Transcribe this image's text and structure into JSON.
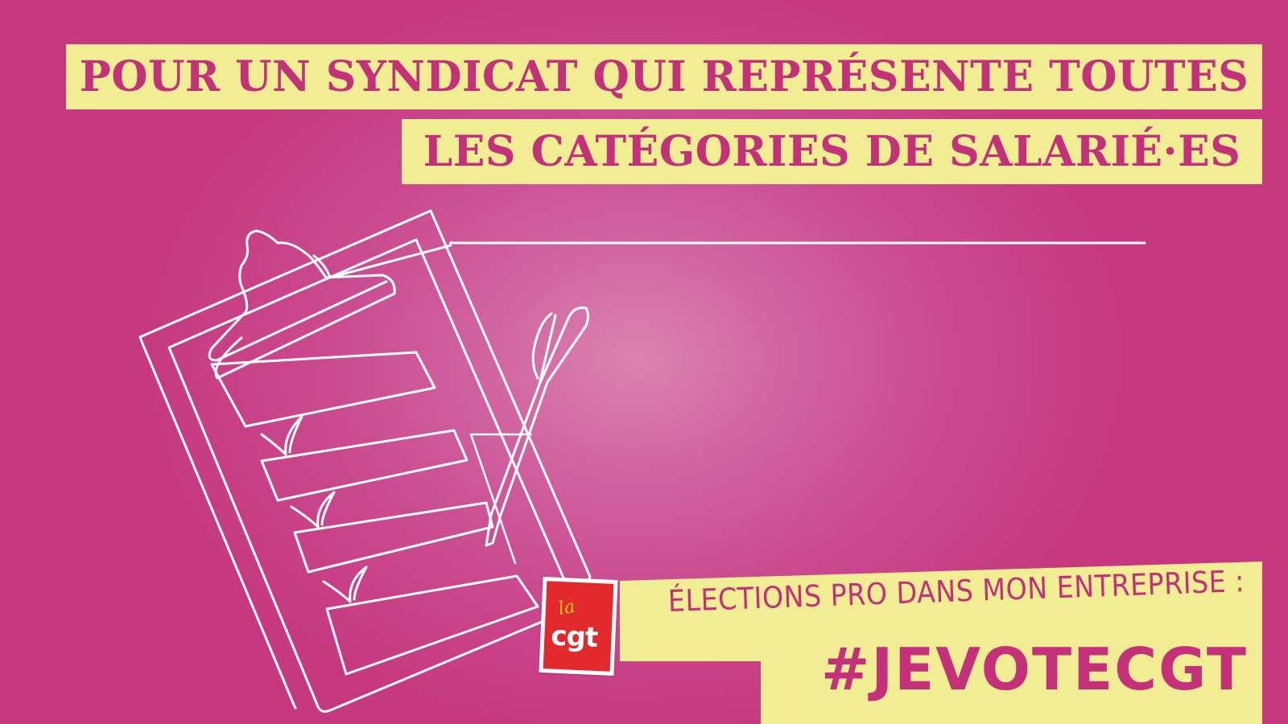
{
  "headline": {
    "line1": "POUR UN SYNDICAT QUI REPRÉSENTE TOUTES",
    "line2": "LES CATÉGORIES DE SALARIÉ·ES"
  },
  "footer": {
    "tagline": "ÉLECTIONS PRO DANS MON ENTREPRISE :",
    "hashtag": "#JEVOTECGT"
  },
  "logo": {
    "la": "la",
    "cgt": "cgt"
  },
  "colors": {
    "background": "#c6387f",
    "band": "#f1ed92",
    "text_accent": "#c5307b",
    "logo_red": "#e22a2c",
    "logo_yellow": "#f7d218",
    "line_art": "#ffffff"
  },
  "icons": {
    "illustration": "clipboard-checklist-with-pen-line-art"
  }
}
